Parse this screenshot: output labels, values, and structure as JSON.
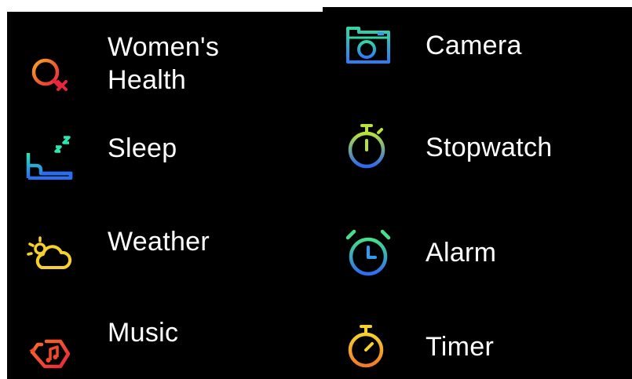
{
  "apps_left": [
    {
      "label": "Women's\nHealth",
      "icon": "womens-health-icon"
    },
    {
      "label": "Sleep",
      "icon": "sleep-icon"
    },
    {
      "label": "Weather",
      "icon": "weather-icon"
    },
    {
      "label": "Music",
      "icon": "music-icon"
    }
  ],
  "apps_right": [
    {
      "label": "Camera",
      "icon": "camera-icon"
    },
    {
      "label": "Stopwatch",
      "icon": "stopwatch-icon"
    },
    {
      "label": "Alarm",
      "icon": "alarm-icon"
    },
    {
      "label": "Timer",
      "icon": "timer-icon"
    }
  ],
  "colors": {
    "background": "#000000",
    "text": "#ffffff",
    "womens_health": [
      "#f5a623",
      "#e8263a"
    ],
    "sleep": [
      "#2ee6b0",
      "#2a6df0"
    ],
    "weather": "#f6d12b",
    "music": "#f04a2a",
    "camera": [
      "#31d6a6",
      "#2f7cf2"
    ],
    "stopwatch": [
      "#b7e23a",
      "#2f67f0"
    ],
    "alarm": [
      "#44e08a",
      "#2f6df2"
    ],
    "timer": [
      "#f6d12b",
      "#f07a2a"
    ]
  }
}
